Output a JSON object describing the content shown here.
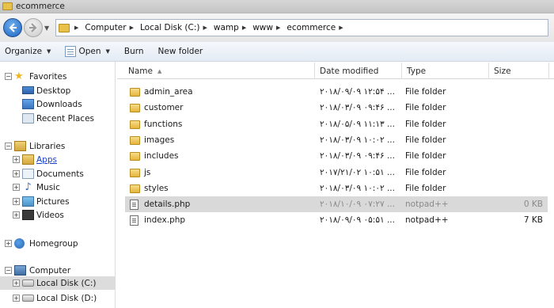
{
  "window": {
    "title": "ecommerce"
  },
  "address": {
    "crumbs": [
      "Computer",
      "Local Disk (C:)",
      "wamp",
      "www",
      "ecommerce"
    ]
  },
  "toolbar": {
    "organize": "Organize",
    "open": "Open",
    "burn": "Burn",
    "new_folder": "New folder"
  },
  "nav": {
    "favorites": "Favorites",
    "desktop": "Desktop",
    "downloads": "Downloads",
    "recent_places": "Recent Places",
    "libraries": "Libraries",
    "apps": "Apps",
    "documents": "Documents",
    "music": "Music",
    "pictures": "Pictures",
    "videos": "Videos",
    "homegroup": "Homegroup",
    "computer": "Computer",
    "local_disk_c": "Local Disk (C:)",
    "local_disk_d": "Local Disk (D:)"
  },
  "columns": {
    "name": "Name",
    "date": "Date modified",
    "type": "Type",
    "size": "Size"
  },
  "files": [
    {
      "name": "admin_area",
      "date": "۲۰۱۸/۰۹/۰۹ ۱۲:۵۴ ...",
      "type": "File folder",
      "size": "",
      "kind": "folder"
    },
    {
      "name": "customer",
      "date": "۲۰۱۸/۰۳/۰۹ ۰۹:۴۶ ...",
      "type": "File folder",
      "size": "",
      "kind": "folder"
    },
    {
      "name": "functions",
      "date": "۲۰۱۸/۰۵/۰۹ ۱۱:۱۳ ...",
      "type": "File folder",
      "size": "",
      "kind": "folder"
    },
    {
      "name": "images",
      "date": "۲۰۱۸/۰۳/۰۹ ۱۰:۰۲ ...",
      "type": "File folder",
      "size": "",
      "kind": "folder"
    },
    {
      "name": "includes",
      "date": "۲۰۱۸/۰۳/۰۹ ۰۹:۴۶ ...",
      "type": "File folder",
      "size": "",
      "kind": "folder"
    },
    {
      "name": "js",
      "date": "۲۰۱۷/۲۱/۰۲ ۱۰:۵۱ ...",
      "type": "File folder",
      "size": "",
      "kind": "folder"
    },
    {
      "name": "styles",
      "date": "۲۰۱۸/۰۳/۰۹ ۱۰:۰۲ ...",
      "type": "File folder",
      "size": "",
      "kind": "folder"
    },
    {
      "name": "details.php",
      "date": "۲۰۱۸/۱۰/۰۹ ۰۷:۲۷ ...",
      "type": "notpad++",
      "size": "0 KB",
      "kind": "file"
    },
    {
      "name": "index.php",
      "date": "۲۰۱۸/۰۹/۰۹ ۰۵:۵۱ ...",
      "type": "notpad++",
      "size": "7 KB",
      "kind": "file"
    }
  ],
  "selected_file": "details.php"
}
